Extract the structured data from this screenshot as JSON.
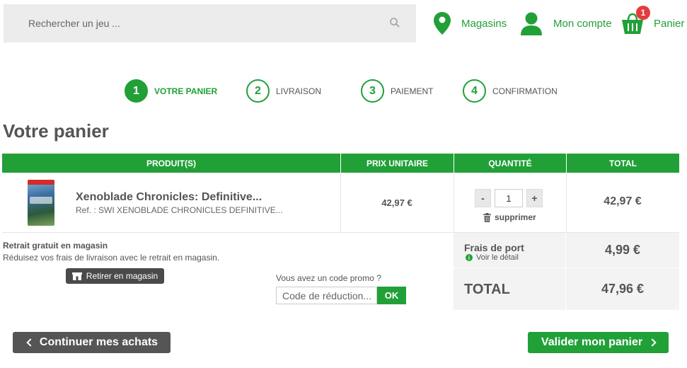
{
  "header": {
    "search_placeholder": "Rechercher un jeu ...",
    "stores_label": "Magasins",
    "account_label": "Mon compte",
    "cart_label": "Panier",
    "cart_count": "1"
  },
  "steps": [
    {
      "number": "1",
      "label": "VOTRE PANIER",
      "active": true
    },
    {
      "number": "2",
      "label": "LIVRAISON",
      "active": false
    },
    {
      "number": "3",
      "label": "PAIEMENT",
      "active": false
    },
    {
      "number": "4",
      "label": "CONFIRMATION",
      "active": false
    }
  ],
  "page_title": "Votre panier",
  "table": {
    "headers": [
      "PRODUIT(S)",
      "PRIX UNITAIRE",
      "QUANTITÉ",
      "TOTAL"
    ],
    "items": [
      {
        "name": "Xenoblade Chronicles: Definitive...",
        "ref": "Ref. : SWI XENOBLADE CHRONICLES DEFINITIVE...",
        "unit_price": "42,97 €",
        "quantity": "1",
        "minus": "-",
        "plus": "+",
        "remove_label": "supprimer",
        "total": "42,97 €"
      }
    ]
  },
  "pickup": {
    "title": "Retrait gratuit en magasin",
    "description": "Réduisez vos frais de livraison avec le retrait en magasin.",
    "button_label": "Retirer en magasin"
  },
  "promo": {
    "label": "Vous avez un code promo ?",
    "placeholder": "Code de réduction...",
    "submit_label": "OK"
  },
  "totals": {
    "shipping_label": "Frais de port",
    "shipping_detail": "Voir le détail",
    "shipping_value": "4,99 €",
    "total_label": "TOTAL",
    "total_value": "47,96 €"
  },
  "actions": {
    "continue_label": "Continuer mes achats",
    "validate_label": "Valider mon panier"
  },
  "colors": {
    "brand_green": "#21a038",
    "badge_red": "#e63b3b",
    "dark_button": "#555555"
  }
}
